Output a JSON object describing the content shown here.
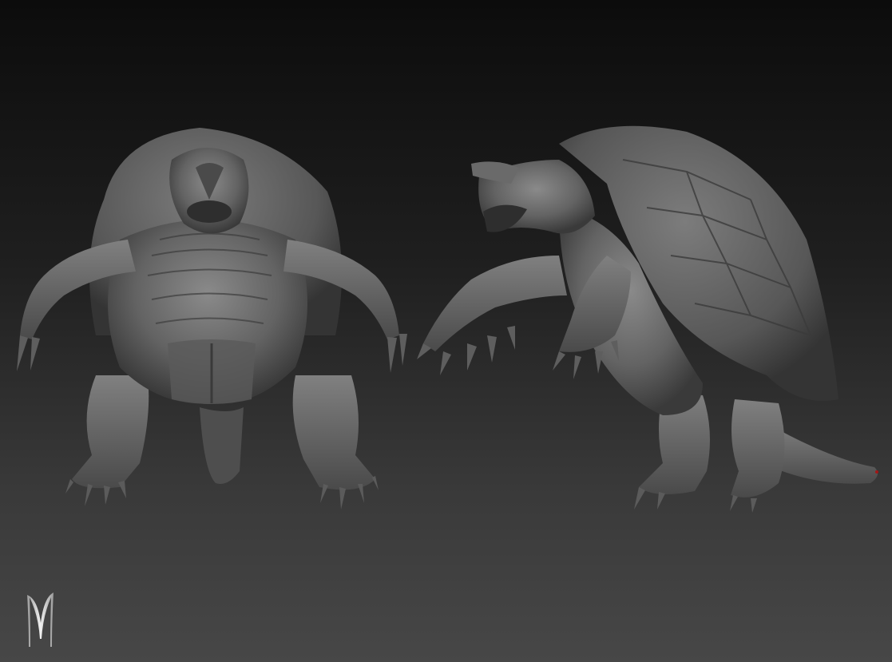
{
  "scene": {
    "subject": "",
    "colors": {
      "background_top": "#0c0c0c",
      "background_bottom": "#474747",
      "clay": "#6e6e6e",
      "clay_dark": "#3c3c3c",
      "clay_light": "#9a9a9a"
    }
  },
  "views": [
    {
      "name": "front-view"
    },
    {
      "name": "side-view"
    }
  ],
  "logo": {
    "icon": "m-monogram-icon"
  }
}
